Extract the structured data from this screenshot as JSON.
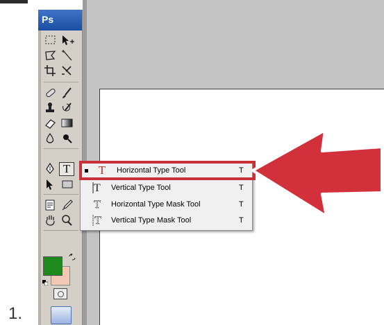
{
  "step": {
    "number": "1."
  },
  "app": {
    "logo": "Ps",
    "name": "Photoshop"
  },
  "toolbox": {
    "tools": [
      {
        "name": "marquee-icon"
      },
      {
        "name": "move-icon"
      },
      {
        "name": "lasso-icon"
      },
      {
        "name": "magic-wand-icon"
      },
      {
        "name": "crop-icon"
      },
      {
        "name": "slice-icon"
      },
      {
        "name": "healing-brush-icon"
      },
      {
        "name": "brush-icon"
      },
      {
        "name": "clone-stamp-icon"
      },
      {
        "name": "history-brush-icon"
      },
      {
        "name": "eraser-icon"
      },
      {
        "name": "gradient-icon"
      },
      {
        "name": "blur-icon"
      },
      {
        "name": "dodge-icon"
      },
      {
        "name": "pen-icon"
      },
      {
        "name": "type-icon"
      },
      {
        "name": "path-selection-icon"
      },
      {
        "name": "shape-icon"
      },
      {
        "name": "notes-icon"
      },
      {
        "name": "eyedropper-icon"
      },
      {
        "name": "hand-icon"
      },
      {
        "name": "zoom-icon"
      }
    ],
    "foreground_color": "#1c8a1c",
    "background_color": "#f3c8b3"
  },
  "flyout": {
    "items": [
      {
        "label": "Horizontal Type Tool",
        "shortcut": "T",
        "selected": true,
        "icon": "horizontal-type-icon"
      },
      {
        "label": "Vertical Type Tool",
        "shortcut": "T",
        "selected": false,
        "icon": "vertical-type-icon"
      },
      {
        "label": "Horizontal Type Mask Tool",
        "shortcut": "T",
        "selected": false,
        "icon": "horizontal-type-mask-icon"
      },
      {
        "label": "Vertical Type Mask Tool",
        "shortcut": "T",
        "selected": false,
        "icon": "vertical-type-mask-icon"
      }
    ]
  },
  "annotation": {
    "highlight_color": "#c9313a",
    "arrow_color": "#d2303b"
  }
}
